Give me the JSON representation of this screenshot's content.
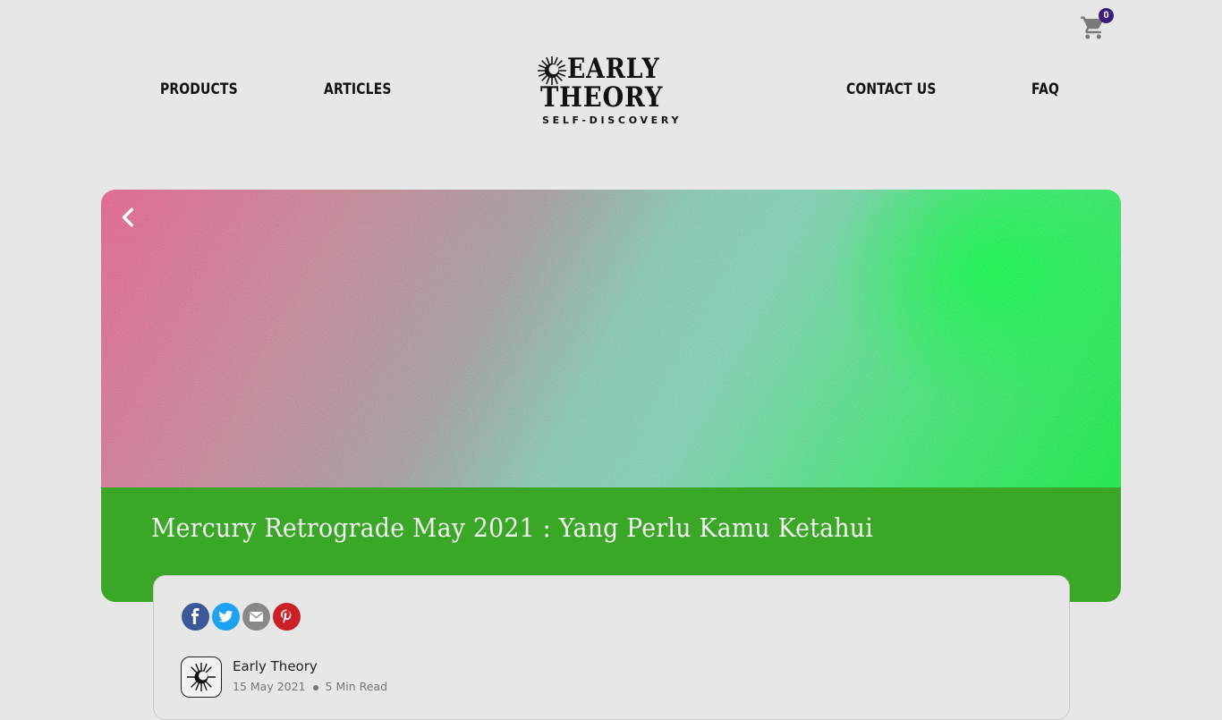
{
  "header": {
    "nav": {
      "products": "PRODUCTS",
      "articles": "ARTICLES",
      "contact": "CONTACT US",
      "faq": "FAQ"
    },
    "logo": {
      "line1": "EARLY",
      "line2": "THEORY",
      "tagline": "SELF-DISCOVERY"
    },
    "cart": {
      "icon": "shopping-cart-icon",
      "count": "0",
      "badge_color": "#3b1f7a"
    }
  },
  "hero": {
    "back_icon": "chevron-left-icon",
    "title": "Mercury Retrograde May 2021 : Yang Perlu Kamu Ketahui",
    "title_bar_color": "#3aa826",
    "gradient_colors": [
      "#e85d8e",
      "#a39ca0",
      "#7dd2b4",
      "#07f03a"
    ]
  },
  "article": {
    "share": [
      {
        "name": "facebook-icon",
        "color": "#3b5998"
      },
      {
        "name": "twitter-icon",
        "color": "#1da1f2"
      },
      {
        "name": "email-icon",
        "color": "#888888"
      },
      {
        "name": "pinterest-icon",
        "color": "#cb2027"
      }
    ],
    "author": "Early Theory",
    "date": "15 May 2021",
    "read_time": "5 Min Read"
  }
}
